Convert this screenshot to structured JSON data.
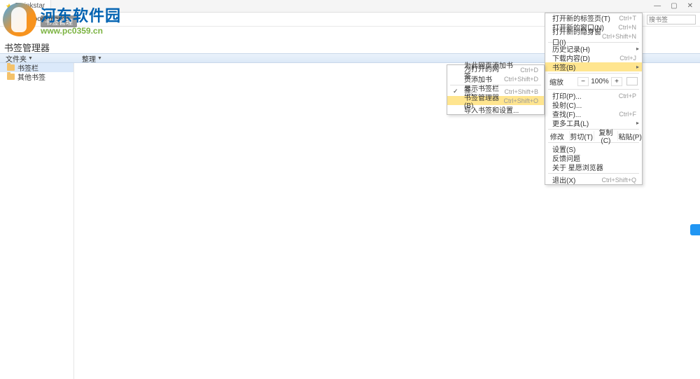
{
  "tab": {
    "title": "Twinkstar",
    "url_label": "chrome://bookmarks"
  },
  "win": {
    "min": "—",
    "max": "▢",
    "close": "✕"
  },
  "nav_icons": {
    "star": "☆",
    "back": "‹",
    "fwd": "›",
    "reload": "⟳",
    "sun": "☼",
    "undo": "↺",
    "menu": "≡"
  },
  "search_placeholder": "搜书签",
  "logo": {
    "cn": "河东软件园",
    "url": "www.pc0359.cn"
  },
  "bm_bar_label": "书签管理",
  "page_title": "书签管理器",
  "toolbar": {
    "left": "文件夹",
    "right": "整理"
  },
  "tree": {
    "item1": "书签栏",
    "item2": "其他书签"
  },
  "main_menu": {
    "new_tab": "打开新的标签页(T)",
    "new_tab_sc": "Ctrl+T",
    "new_win": "打开新的窗口(N)",
    "new_win_sc": "Ctrl+N",
    "incog": "打开新的隐身窗口(I)",
    "incog_sc": "Ctrl+Shift+N",
    "history": "历史记录(H)",
    "downloads": "下载内容(D)",
    "downloads_sc": "Ctrl+J",
    "bookmarks": "书签(B)",
    "zoom_label": "缩放",
    "zoom_minus": "−",
    "zoom_val": "100%",
    "zoom_plus": "+",
    "print": "打印(P)...",
    "print_sc": "Ctrl+P",
    "cast": "投射(C)...",
    "find": "查找(F)...",
    "find_sc": "Ctrl+F",
    "more_tools": "更多工具(L)",
    "edit_label": "修改",
    "cut": "剪切(T)",
    "copy": "复制(C)",
    "paste": "粘贴(P)",
    "settings": "设置(S)",
    "feedback": "反馈问题",
    "about": "关于 星愿浏览器",
    "exit": "退出(X)",
    "exit_sc": "Ctrl+Shift+Q"
  },
  "sub_menu": {
    "add_page": "为此网页添加书签...",
    "add_page_sc": "Ctrl+D",
    "add_all": "为打开的网页添加书签...",
    "add_all_sc": "Ctrl+Shift+D",
    "show_bar": "显示书签栏(S)",
    "show_bar_sc": "Ctrl+Shift+B",
    "manager": "书签管理器(B)",
    "manager_sc": "Ctrl+Shift+O",
    "import": "导入书签和设置..."
  }
}
